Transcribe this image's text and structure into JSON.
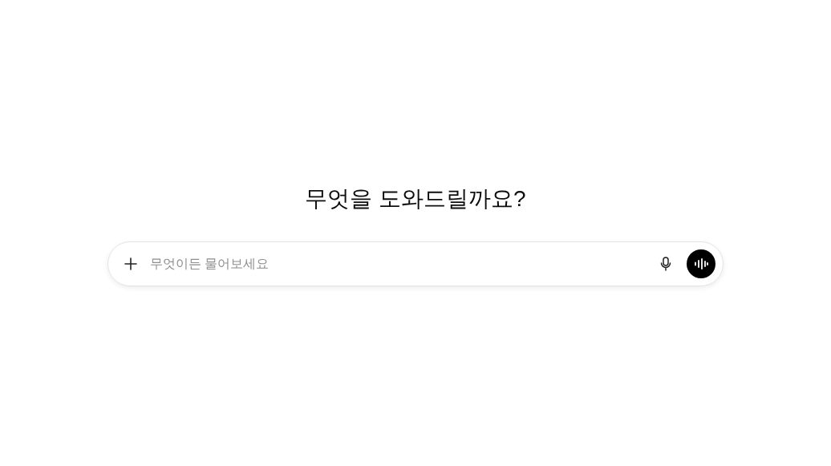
{
  "heading": "무엇을 도와드릴까요?",
  "composer": {
    "placeholder": "무엇이든 물어보세요"
  }
}
